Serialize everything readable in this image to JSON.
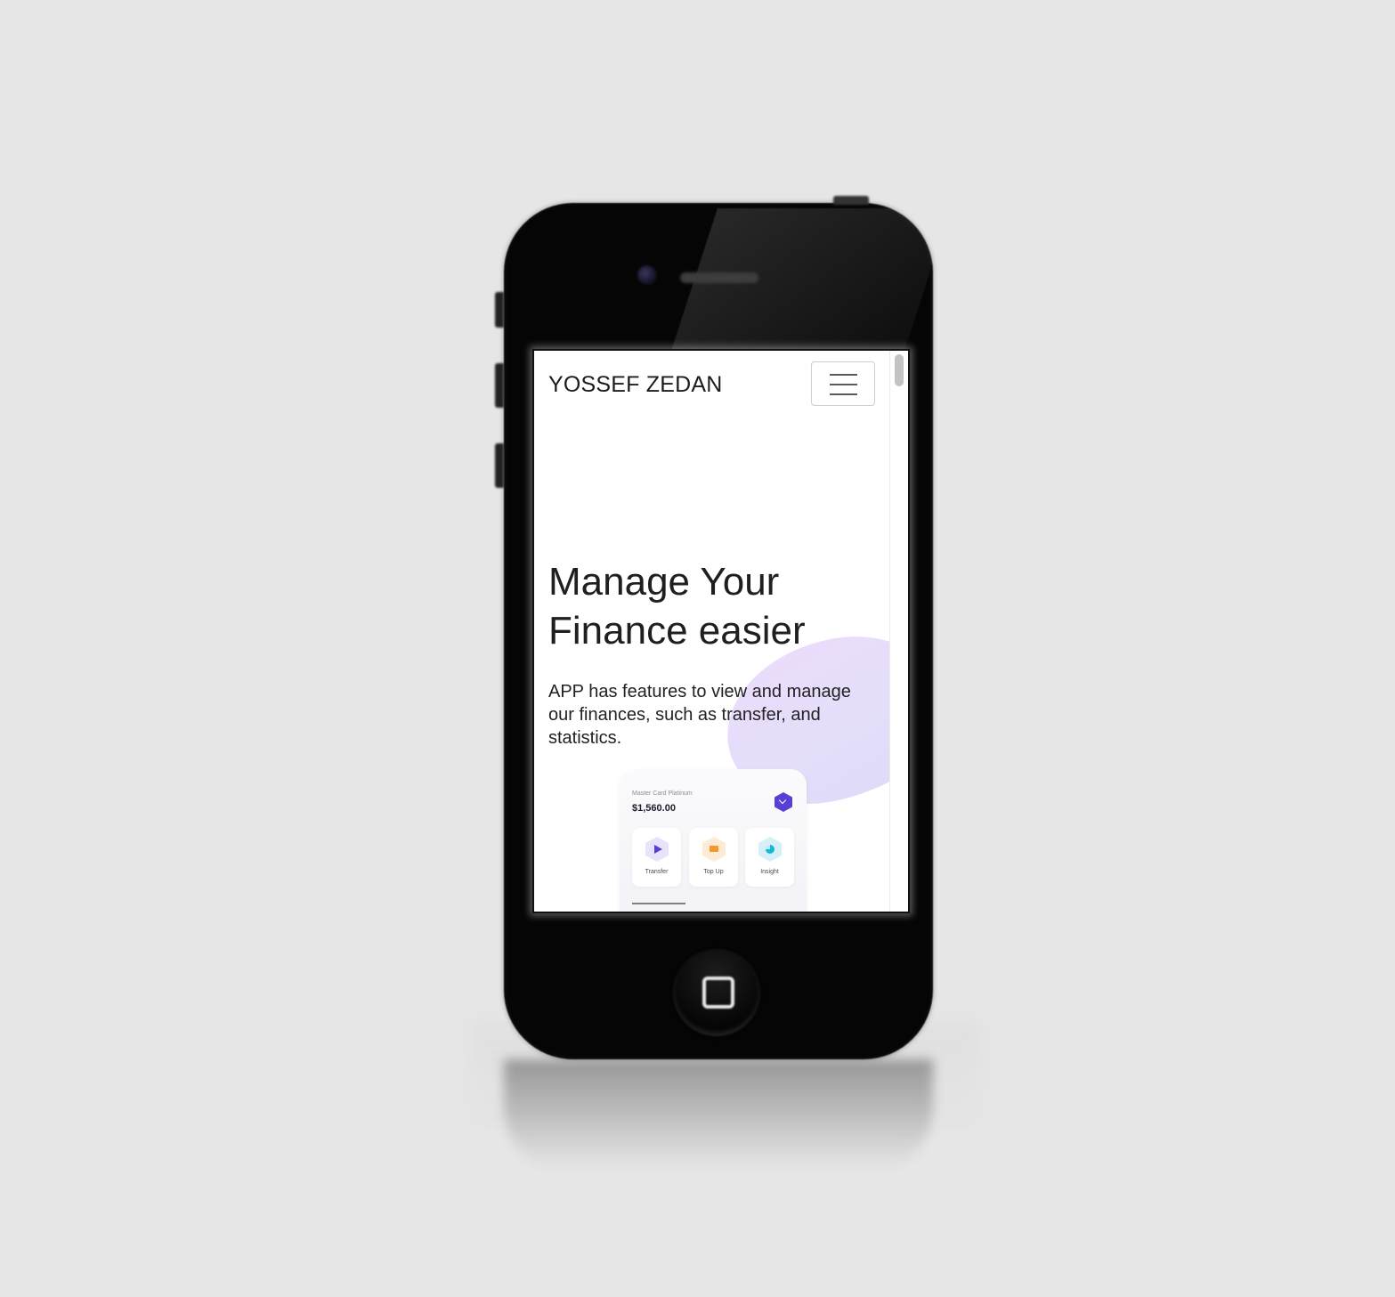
{
  "header": {
    "brand": "YOSSEF ZEDAN",
    "menu_toggle": "hamburger-menu-icon"
  },
  "hero": {
    "title_line1": "Manage Your",
    "title_line2": "Finance easier",
    "description": "APP has features to view and manage our finances, such as transfer, and statistics."
  },
  "app_preview": {
    "card_name": "Master Card Platinum",
    "balance": "$1,560.00",
    "actions": [
      {
        "label": "Transfer",
        "icon": "send-icon",
        "color": "#5a3fd6",
        "bg": "#e8e3fb"
      },
      {
        "label": "Top Up",
        "icon": "card-icon",
        "color": "#f39a2f",
        "bg": "#fdebd5"
      },
      {
        "label": "Insight",
        "icon": "pie-chart-icon",
        "color": "#16b8d8",
        "bg": "#d5f1f7"
      }
    ]
  },
  "colors": {
    "accent": "#5a3fd6",
    "blob": "#e3defa",
    "page_background": "#e6e6e6",
    "phone_body": "#050505"
  }
}
